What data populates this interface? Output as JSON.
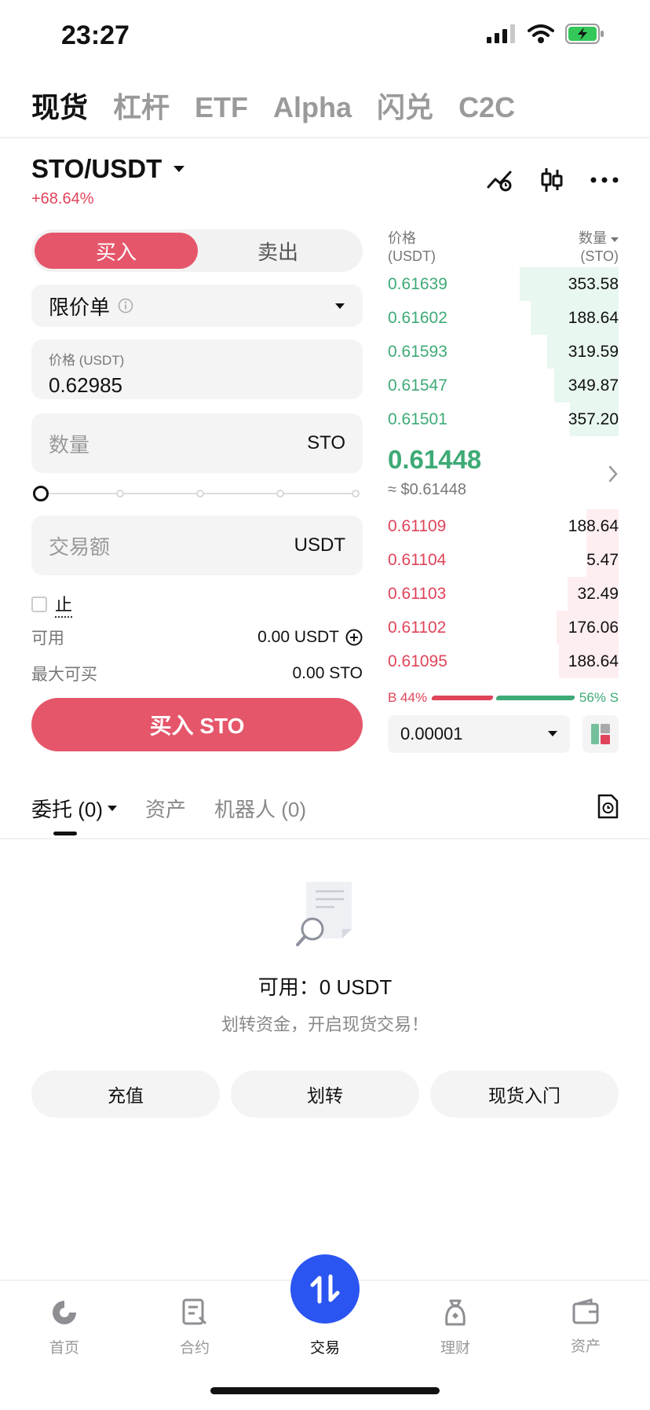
{
  "status_bar": {
    "time": "23:27"
  },
  "top_tabs": [
    "现货",
    "杠杆",
    "ETF",
    "Alpha",
    "闪兑",
    "C2C"
  ],
  "pair": {
    "symbol": "STO/USDT",
    "change": "+68.64%"
  },
  "trade_side": {
    "buy": "买入",
    "sell": "卖出"
  },
  "order_form": {
    "order_type": "限价单",
    "price_label": "价格 (USDT)",
    "price_value": "0.62985",
    "qty_placeholder": "数量",
    "qty_unit": "STO",
    "slider_percent": 0,
    "amount_placeholder": "交易额",
    "amount_unit": "USDT",
    "stop_label": "止",
    "available_label": "可用",
    "available_value": "0.00 USDT",
    "max_buy_label": "最大可买",
    "max_buy_value": "0.00 STO",
    "submit": "买入 STO"
  },
  "order_book": {
    "price_header": "价格",
    "price_unit": "(USDT)",
    "qty_header": "数量",
    "qty_unit": "(STO)",
    "asks": [
      {
        "price": "0.61639",
        "qty": "353.58",
        "depth": 0.43
      },
      {
        "price": "0.61602",
        "qty": "188.64",
        "depth": 0.38
      },
      {
        "price": "0.61593",
        "qty": "319.59",
        "depth": 0.31
      },
      {
        "price": "0.61547",
        "qty": "349.87",
        "depth": 0.28
      },
      {
        "price": "0.61501",
        "qty": "357.20",
        "depth": 0.21
      }
    ],
    "last_price": "0.61448",
    "last_price_usd": "≈ $0.61448",
    "bids": [
      {
        "price": "0.61109",
        "qty": "188.64",
        "depth": 0.14
      },
      {
        "price": "0.61104",
        "qty": "5.47",
        "depth": 0.14
      },
      {
        "price": "0.61103",
        "qty": "32.49",
        "depth": 0.22
      },
      {
        "price": "0.61102",
        "qty": "176.06",
        "depth": 0.27
      },
      {
        "price": "0.61095",
        "qty": "188.64",
        "depth": 0.26
      }
    ],
    "buy_ratio_label": "B 44%",
    "sell_ratio_label": "56% S",
    "buy_ratio": 0.44,
    "precision": "0.00001"
  },
  "sub_tabs": [
    "委托 (0)",
    "资产",
    "机器人 (0)"
  ],
  "empty_state": {
    "title": "可用：0 USDT",
    "subtitle": "划转资金，开启现货交易！"
  },
  "actions": [
    "充值",
    "划转",
    "现货入门"
  ],
  "bottom_nav": [
    "首页",
    "合约",
    "交易",
    "理财",
    "资产"
  ],
  "colors": {
    "buy": "#e5566a",
    "ask_green": "#3eaa76",
    "bid_red": "#e0445a",
    "accent_blue": "#2a55f0"
  }
}
